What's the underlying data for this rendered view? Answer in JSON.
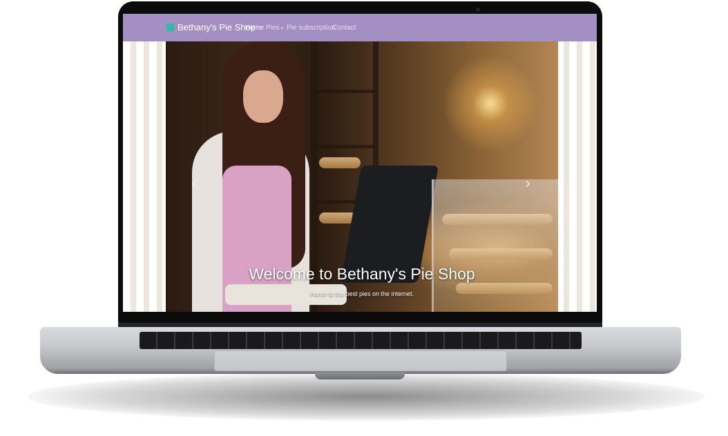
{
  "navbar": {
    "brand": "Bethany's Pie Shop",
    "items": [
      {
        "label": "Home",
        "active": true
      },
      {
        "label": "Pies",
        "dropdown": true
      },
      {
        "label": "Pie subscription"
      },
      {
        "label": "Contact"
      }
    ]
  },
  "carousel": {
    "caption_title": "Welcome to Bethany's Pie Shop",
    "caption_text": "Home to the best pies on the internet.",
    "prev_icon": "‹",
    "next_icon": "›"
  },
  "colors": {
    "navbar": "#a48fc3",
    "brand_icon": "#2fb8a6",
    "stripe": "#ece7de"
  },
  "icons": {
    "brand": "pie-logo-icon",
    "dropdown": "caret-down-icon",
    "prev": "chevron-left-icon",
    "next": "chevron-right-icon"
  }
}
